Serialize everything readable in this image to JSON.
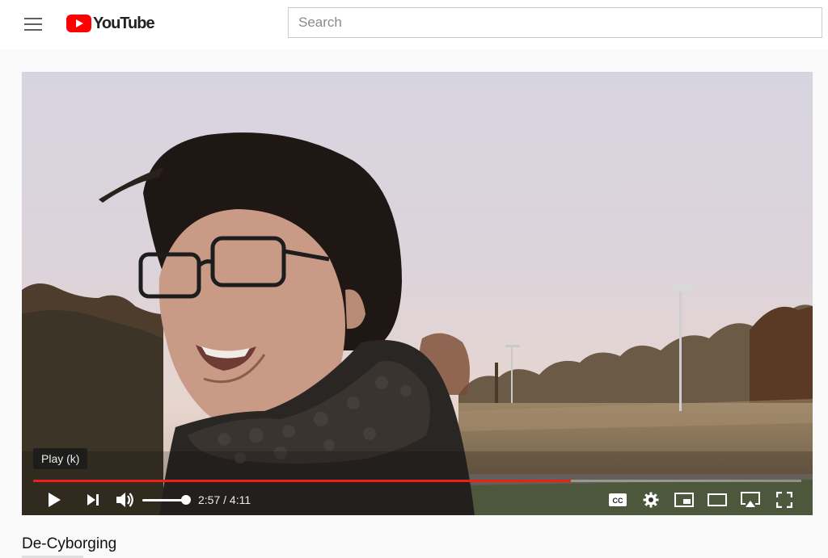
{
  "header": {
    "logo_text": "YouTube",
    "search_placeholder": "Search"
  },
  "player": {
    "tooltip": "Play (k)",
    "current_time": "2:57",
    "separator": " / ",
    "duration": "4:11",
    "progress_fraction": 0.7,
    "volume_fraction": 1.0,
    "progress_color": "#e8211c",
    "controls": [
      "play-icon",
      "next-icon",
      "volume-icon",
      "cc-icon",
      "settings-icon",
      "miniplayer-icon",
      "theater-icon",
      "airplay-icon",
      "fullscreen-icon"
    ]
  },
  "video": {
    "title": "De-Cyborging"
  }
}
